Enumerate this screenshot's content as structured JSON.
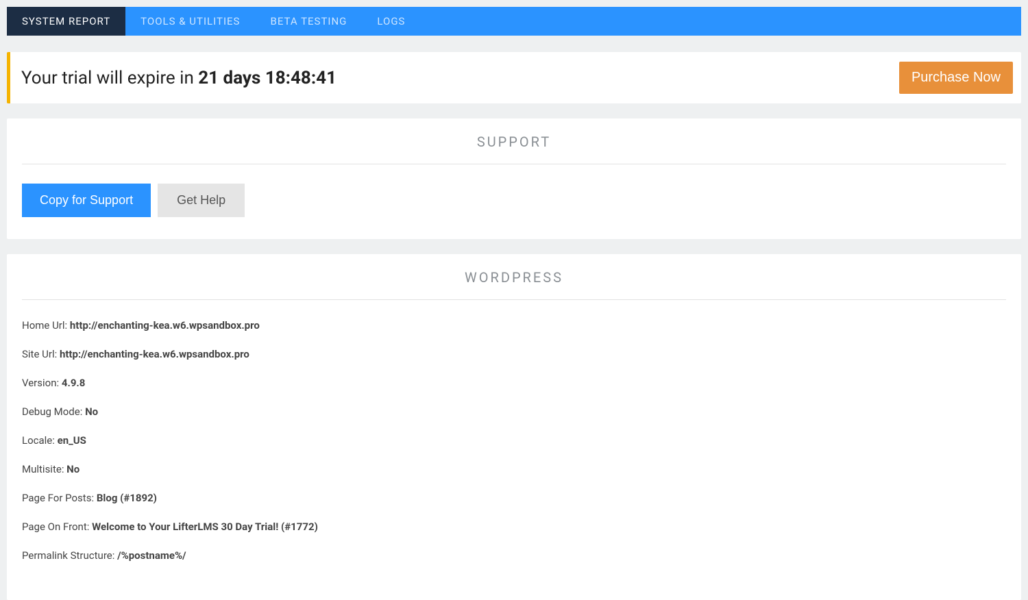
{
  "tabs": [
    {
      "label": "SYSTEM REPORT",
      "active": true
    },
    {
      "label": "TOOLS & UTILITIES",
      "active": false
    },
    {
      "label": "BETA TESTING",
      "active": false
    },
    {
      "label": "LOGS",
      "active": false
    }
  ],
  "trial": {
    "prefix": "Your trial will expire in ",
    "countdown": "21 days 18:48:41",
    "purchase_label": "Purchase Now"
  },
  "support": {
    "title": "SUPPORT",
    "copy_label": "Copy for Support",
    "help_label": "Get Help"
  },
  "wordpress": {
    "title": "WORDPRESS",
    "rows": [
      {
        "label": "Home Url: ",
        "value": "http://enchanting-kea.w6.wpsandbox.pro"
      },
      {
        "label": "Site Url: ",
        "value": "http://enchanting-kea.w6.wpsandbox.pro"
      },
      {
        "label": "Version: ",
        "value": "4.9.8"
      },
      {
        "label": "Debug Mode: ",
        "value": "No"
      },
      {
        "label": "Locale: ",
        "value": "en_US"
      },
      {
        "label": "Multisite: ",
        "value": "No"
      },
      {
        "label": "Page For Posts: ",
        "value": "Blog (#1892)"
      },
      {
        "label": "Page On Front: ",
        "value": "Welcome to Your LifterLMS 30 Day Trial! (#1772)"
      },
      {
        "label": "Permalink Structure: ",
        "value": "/%postname%/"
      }
    ]
  }
}
